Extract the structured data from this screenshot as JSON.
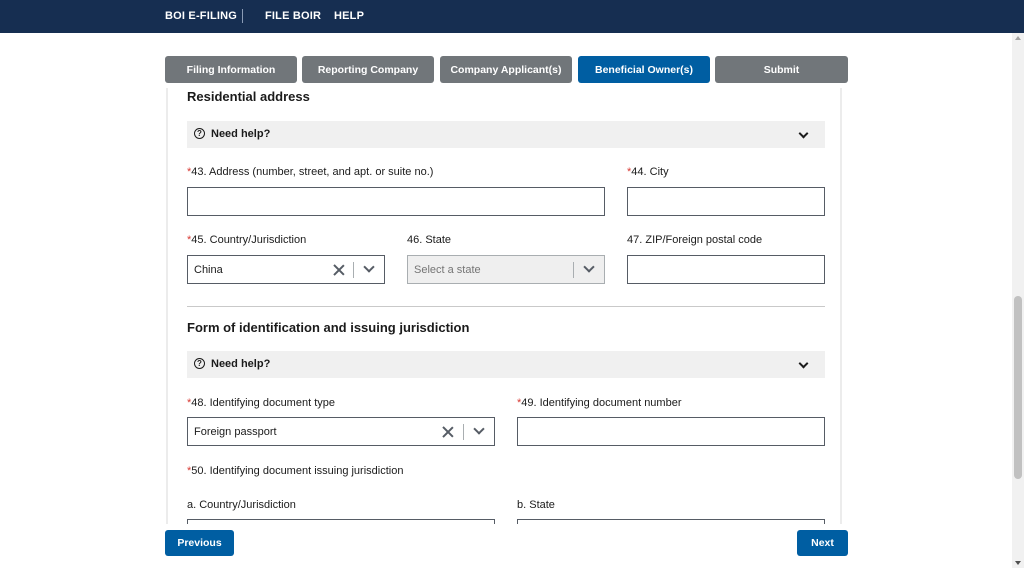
{
  "topbar": {
    "brand": "BOI E-FILING",
    "links": [
      "FILE BOIR",
      "HELP"
    ]
  },
  "steps": [
    {
      "label": "Filing Information",
      "active": false
    },
    {
      "label": "Reporting Company",
      "active": false
    },
    {
      "label": "Company Applicant(s)",
      "active": false
    },
    {
      "label": "Beneficial Owner(s)",
      "active": true
    },
    {
      "label": "Submit",
      "active": false
    }
  ],
  "residential": {
    "title": "Residential address",
    "help_label": "Need help?",
    "address_label": "43. Address (number, street, and apt. or suite no.)",
    "address_value": "",
    "city_label": "44. City",
    "city_value": "",
    "country_label": "45. Country/Jurisdiction",
    "country_value": "China",
    "state_label": "46. State",
    "state_placeholder": "Select a state",
    "zip_label": "47. ZIP/Foreign postal code",
    "zip_value": ""
  },
  "identification": {
    "title": "Form of identification and issuing jurisdiction",
    "help_label": "Need help?",
    "doc_type_label": "48. Identifying document type",
    "doc_type_value": "Foreign passport",
    "doc_number_label": "49. Identifying document number",
    "doc_number_value": "",
    "jurisdiction_label": "50. Identifying document issuing jurisdiction",
    "country_label": "a. Country/Jurisdiction",
    "state_label": "b. State"
  },
  "required_marker": "*",
  "footer": {
    "previous_label": "Previous",
    "next_label": "Next"
  },
  "colors": {
    "header_bg": "#162e51",
    "accent": "#005ea2",
    "step_inactive": "#71767a",
    "required": "#d83933"
  }
}
